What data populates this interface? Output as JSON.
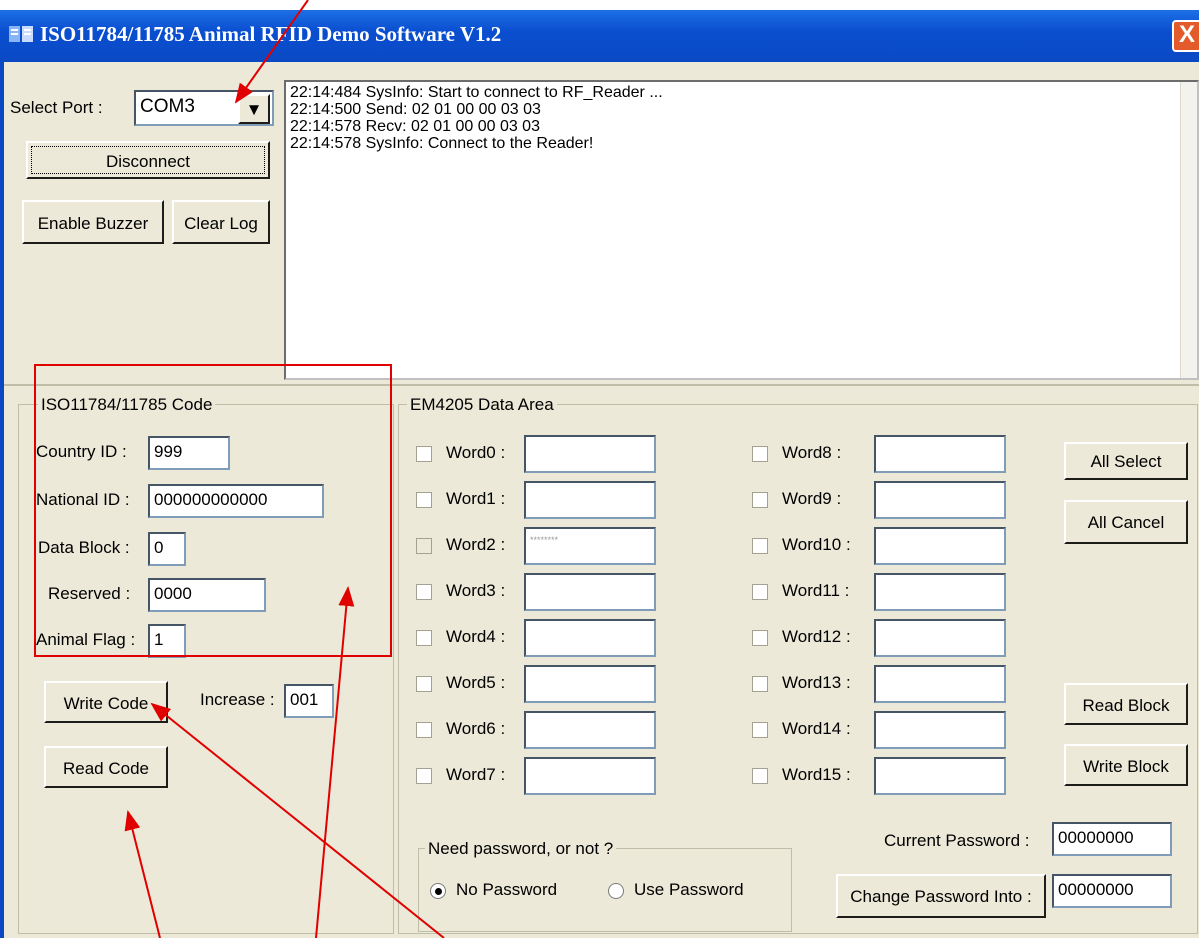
{
  "window": {
    "title": "ISO11784/11785 Animal RFID Demo Software V1.2",
    "close_glyph": "X"
  },
  "connection": {
    "select_port_label": "Select Port :",
    "port_value": "COM3",
    "disconnect_label": "Disconnect",
    "enable_buzzer_label": "Enable Buzzer",
    "clear_log_label": "Clear Log"
  },
  "log": {
    "lines": [
      "22:14:484 SysInfo: Start to connect to RF_Reader ...",
      "22:14:500 Send: 02 01 00 00 03 03",
      "22:14:578 Recv: 02 01 00 00 03 03",
      "22:14:578 SysInfo: Connect to the Reader!"
    ]
  },
  "iso_code": {
    "group_title": "ISO11784/11785 Code",
    "country_id_label": "Country ID :",
    "country_id_value": "999",
    "national_id_label": "National ID :",
    "national_id_value": "000000000000",
    "data_block_label": "Data  Block :",
    "data_block_value": "0",
    "reserved_label": "Reserved :",
    "reserved_value": "0000",
    "animal_flag_label": "Animal Flag :",
    "animal_flag_value": "1",
    "write_code_label": "Write Code",
    "increase_label": "Increase :",
    "increase_value": "001",
    "read_code_label": "Read Code"
  },
  "em4205": {
    "group_title": "EM4205 Data Area",
    "words_left": [
      "Word0 :",
      "Word1 :",
      "Word2 :",
      "Word3 :",
      "Word4 :",
      "Word5 :",
      "Word6 :",
      "Word7 :"
    ],
    "words_right": [
      "Word8  :",
      "Word9  :",
      "Word10 :",
      "Word11 :",
      "Word12 :",
      "Word13 :",
      "Word14 :",
      "Word15 :"
    ],
    "word2_value": "********",
    "all_select_label": "All Select",
    "all_cancel_label": "All Cancel",
    "read_block_label": "Read Block",
    "write_block_label": "Write Block",
    "password_group_title": "Need password, or not ?",
    "no_password_label": "No  Password",
    "use_password_label": "Use Password",
    "current_password_label": "Current Password :",
    "current_password_value": "00000000",
    "change_password_label": "Change Password Into :",
    "change_password_value": "00000000"
  },
  "colors": {
    "title_bar": "#0a49c4",
    "window_bg": "#ece9d8",
    "annotation": "#e00000"
  }
}
